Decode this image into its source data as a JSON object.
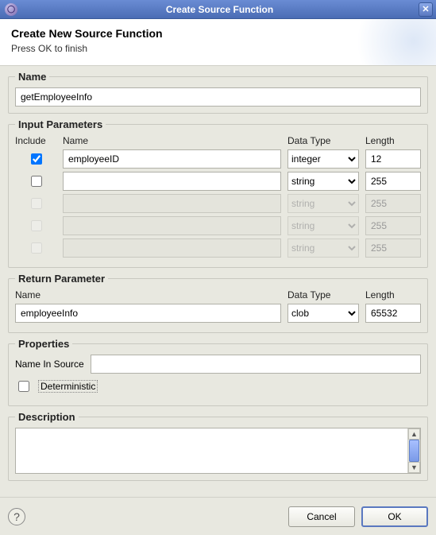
{
  "window": {
    "title": "Create Source Function"
  },
  "banner": {
    "heading": "Create New Source Function",
    "sub": "Press OK to finish"
  },
  "name_section": {
    "legend": "Name",
    "value": "getEmployeeInfo"
  },
  "input_params": {
    "legend": "Input Parameters",
    "headers": {
      "include": "Include",
      "name": "Name",
      "type": "Data Type",
      "length": "Length"
    },
    "rows": [
      {
        "include": true,
        "name": "employeeID",
        "type": "integer",
        "length": "12",
        "enabled": true
      },
      {
        "include": false,
        "name": "",
        "type": "string",
        "length": "255",
        "enabled": true
      },
      {
        "include": false,
        "name": "",
        "type": "string",
        "length": "255",
        "enabled": false
      },
      {
        "include": false,
        "name": "",
        "type": "string",
        "length": "255",
        "enabled": false
      },
      {
        "include": false,
        "name": "",
        "type": "string",
        "length": "255",
        "enabled": false
      }
    ]
  },
  "return_param": {
    "legend": "Return Parameter",
    "headers": {
      "name": "Name",
      "type": "Data Type",
      "length": "Length"
    },
    "name": "employeeInfo",
    "type": "clob",
    "length": "65532"
  },
  "properties": {
    "legend": "Properties",
    "name_in_source_label": "Name In Source",
    "name_in_source_value": "",
    "deterministic_label": "Deterministic",
    "deterministic_checked": false
  },
  "description": {
    "legend": "Description",
    "value": ""
  },
  "footer": {
    "cancel": "Cancel",
    "ok": "OK"
  },
  "type_options": [
    "integer",
    "string",
    "clob"
  ]
}
